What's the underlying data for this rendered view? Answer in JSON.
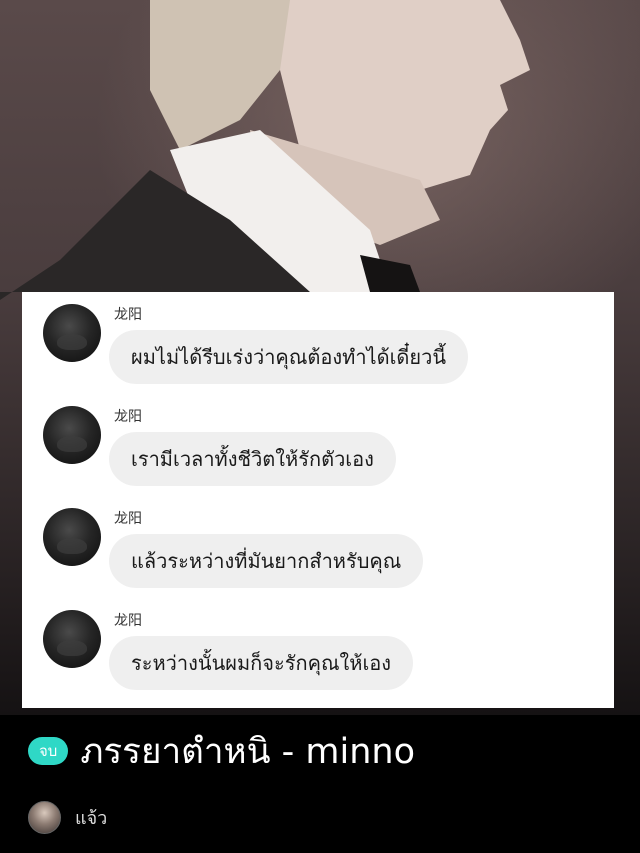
{
  "cover": {
    "image": "profile-photo-background"
  },
  "chat": {
    "messages": [
      {
        "sender": "龙阳",
        "text": "ผมไม่ได้รีบเร่งว่าคุณต้องทำได้เดี๋ยวนี้"
      },
      {
        "sender": "龙阳",
        "text": "เรามีเวลาทั้งชีวิตให้รักตัวเอง"
      },
      {
        "sender": "龙阳",
        "text": "แล้วระหว่างที่มันยากสำหรับคุณ"
      },
      {
        "sender": "龙阳",
        "text": "ระหว่างนั้นผมก็จะรักคุณให้เอง"
      }
    ]
  },
  "story": {
    "badge": "จบ",
    "title": "ภรรยาตำหนิ - minno",
    "badge_color": "#2fd8c6"
  },
  "author": {
    "status": "แจ้ว"
  }
}
